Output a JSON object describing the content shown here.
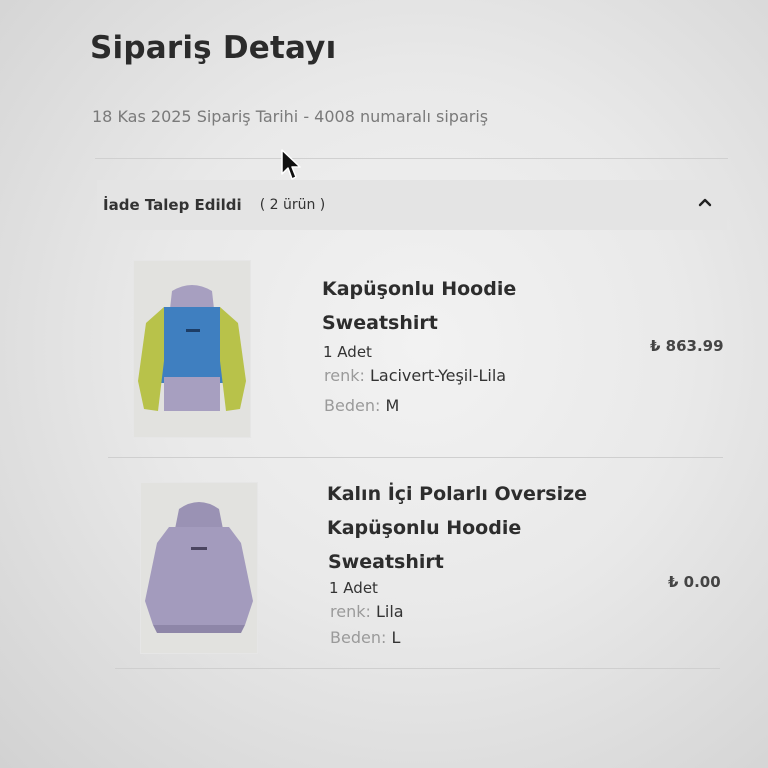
{
  "page": {
    "title": "Sipariş Detayı",
    "subtitle": "18 Kas 2025 Sipariş Tarihi - 4008 numaralı sipariş"
  },
  "group": {
    "status": "İade Talep Edildi",
    "count": "( 2 ürün )",
    "expanded": true
  },
  "labels": {
    "color_label": "renk:",
    "size_label": "Beden:"
  },
  "items": [
    {
      "name_line1": "Kapüşonlu Hoodie",
      "name_line2": "Sweatshirt",
      "quantity": "1 Adet",
      "color": "Lacivert-Yeşil-Lila",
      "size": "M",
      "price": "₺ 863.99",
      "image_icon": "hoodie-colorblock-image"
    },
    {
      "name_line1": "Kalın İçi Polarlı Oversize",
      "name_line2": "Kapüşonlu Hoodie",
      "name_line3": "Sweatshirt",
      "quantity": "1 Adet",
      "color": "Lila",
      "size": "L",
      "price": "₺ 0.00",
      "image_icon": "hoodie-lilac-image"
    }
  ],
  "colors": {
    "hoodie_blue": "#3f7fc0",
    "hoodie_green": "#b8c24a",
    "hoodie_lilac": "#a39bbd"
  }
}
